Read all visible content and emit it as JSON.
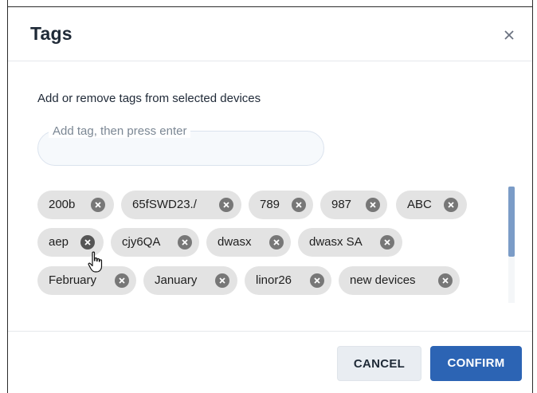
{
  "dialog": {
    "title": "Tags",
    "close_icon": "close-icon",
    "description": "Add or remove tags from selected devices",
    "input": {
      "label": "Add tag, then press enter",
      "value": ""
    },
    "tags": [
      "200b",
      "65fSWD23./",
      "789",
      "987",
      "ABC",
      "aep",
      "cjy6QA",
      "dwasx",
      "dwasx SA",
      "February",
      "January",
      "linor26",
      "new devices"
    ],
    "buttons": {
      "cancel": "CANCEL",
      "confirm": "CONFIRM"
    }
  },
  "colors": {
    "chip_bg": "#e3e3e3",
    "chip_remove": "#777777",
    "confirm_bg": "#2c64b4",
    "cancel_bg": "#e9edf2",
    "scroll_thumb": "#7b9cc7"
  }
}
